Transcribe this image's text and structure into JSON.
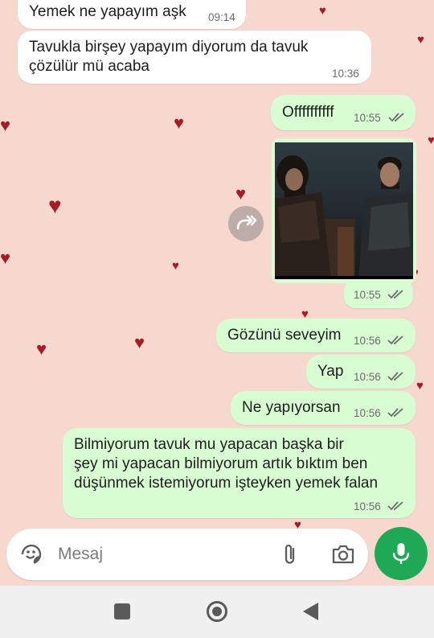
{
  "messages": [
    {
      "direction": "in",
      "text": "Yemek ne yapayım aşk",
      "time": "09:14"
    },
    {
      "direction": "in",
      "lines": [
        "Tavukla birşey yapayım diyorum da tavuk",
        "çözülür mü acaba"
      ],
      "time": "10:36"
    },
    {
      "direction": "out",
      "text": "Offffffffff",
      "time": "10:55",
      "status": "read"
    },
    {
      "direction": "out",
      "type": "image",
      "time": "10:55",
      "status": "read"
    },
    {
      "direction": "out",
      "text": "Gözünü seveyim",
      "time": "10:56",
      "status": "read"
    },
    {
      "direction": "out",
      "text": "Yap",
      "time": "10:56",
      "status": "read"
    },
    {
      "direction": "out",
      "text": "Ne yapıyorsan",
      "time": "10:56",
      "status": "read"
    },
    {
      "direction": "out",
      "lines": [
        "Bilmiyorum tavuk mu yapacan başka bir",
        "şey mi yapacan bilmiyorum artık bıktım ben",
        "düşünmek istemiyorum işteyken yemek falan"
      ],
      "time": "10:56",
      "status": "read"
    }
  ],
  "input": {
    "placeholder": "Mesaj"
  },
  "icons": {
    "sticker": "sticker-icon",
    "attach": "paperclip-icon",
    "camera": "camera-icon",
    "mic": "microphone-icon",
    "forward": "forward-icon",
    "nav_recents": "square-icon",
    "nav_home": "circle-icon",
    "nav_back": "back-triangle-icon",
    "ticks": "double-check-icon",
    "wallpaper": "heart-icon"
  },
  "colors": {
    "wallpaper": "#f6d8cf",
    "heart": "#a61b26",
    "incoming_bubble": "#ffffff",
    "outgoing_bubble": "#d9fdd3",
    "mic_button": "#1fa855",
    "read_ticks": "#6b6b6b"
  }
}
